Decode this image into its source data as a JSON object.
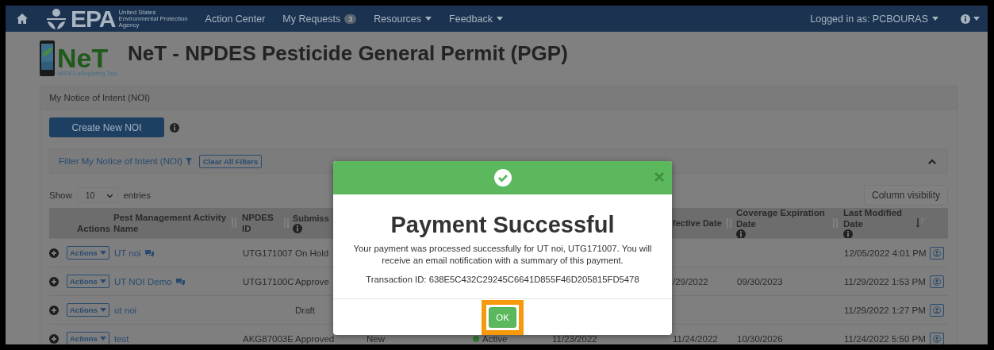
{
  "nav": {
    "brand": "EPA",
    "brand_lines": [
      "United States",
      "Environmental Protection",
      "Agency"
    ],
    "items": [
      {
        "label": "Action Center",
        "kind": "link"
      },
      {
        "label": "My Requests",
        "kind": "badge",
        "badge": "3"
      },
      {
        "label": "Resources",
        "kind": "dropdown"
      },
      {
        "label": "Feedback",
        "kind": "dropdown"
      }
    ],
    "user": "Logged in as: PCBOURAS"
  },
  "app": {
    "logo_text": "NeT",
    "logo_subtitle": "NPDES eReporting Tool",
    "title": "NeT - NPDES Pesticide General Permit (PGP)"
  },
  "panel": {
    "title": "My Notice of Intent (NOI)",
    "create_button": "Create New NOI",
    "filter": {
      "label": "Filter My Notice of Intent (NOI)",
      "clear_button": "Clear All Filters",
      "expanded": true
    },
    "show_label": "Show",
    "page_size": "10",
    "entries_label": "entries",
    "column_visibility_button": "Column visibility"
  },
  "table": {
    "columns": [
      {
        "label": "Actions",
        "sortable": false,
        "info": false
      },
      {
        "label": "Pest Management Activity Name",
        "sortable": true,
        "sorted": false,
        "info": false
      },
      {
        "label": "NPDES ID",
        "sortable": true,
        "sorted": false,
        "info": false
      },
      {
        "label": "Submiss",
        "sortable": false,
        "info": true
      },
      {
        "label": "fective Date",
        "sortable": true,
        "sorted": false,
        "info": false
      },
      {
        "label": "Coverage Expiration Date",
        "sortable": true,
        "sorted": false,
        "info": true
      },
      {
        "label": "Last Modified Date",
        "sortable": true,
        "sorted": true,
        "info": true
      }
    ],
    "rows": [
      {
        "actions_label": "Actions",
        "name": "UT noi",
        "comments": true,
        "npdes_id": "UTG171007",
        "submission": "On Hold",
        "last_modified": "12/05/2022 4:01 PM"
      },
      {
        "actions_label": "Actions",
        "name": "UT NOI Demo",
        "comments": true,
        "npdes_id": "UTG17100C",
        "submission": "Approve",
        "effective_date": "/29/2022",
        "coverage_expiration": "09/30/2023",
        "last_modified": "11/29/2022 1:53 PM"
      },
      {
        "actions_label": "Actions",
        "name": "ut noi",
        "comments": false,
        "submission": "Draft",
        "last_modified": "11/29/2022 1:27 PM"
      },
      {
        "actions_label": "Actions",
        "name": "test",
        "comments": false,
        "npdes_id": "AKG87003E",
        "submission": "Approved",
        "column_5": "New",
        "status": "Active",
        "column_7": "11/23/2022",
        "effective_date": "11/24/2022",
        "coverage_expiration": "10/30/2026",
        "last_modified": "11/24/2022 5:50 PM"
      }
    ]
  },
  "modal": {
    "title": "Payment Successful",
    "message": "Your payment was processed successfully for UT noi, UTG171007. You will receive an email notification with a summary of this payment.",
    "transaction": "Transaction ID: 638E5C432C29245C6641D855F46D205815FD5478",
    "ok_button": "OK",
    "highlighted": true
  }
}
